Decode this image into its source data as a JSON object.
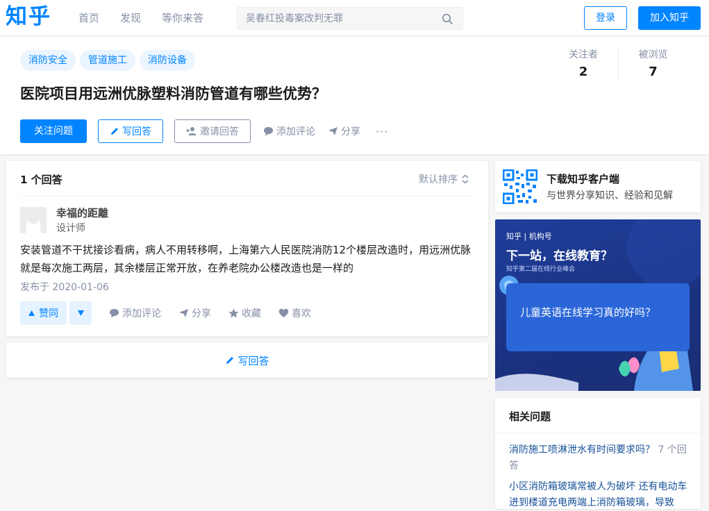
{
  "header": {
    "logo": "知乎",
    "nav": [
      "首页",
      "发现",
      "等你来答"
    ],
    "search_placeholder": "吴春红投毒案改判无罪",
    "login": "登录",
    "join": "加入知乎"
  },
  "question": {
    "tags": [
      "消防安全",
      "管道施工",
      "消防设备"
    ],
    "title": "医院项目用远洲优脉塑料消防管道有哪些优势？",
    "followers_label": "关注者",
    "followers": "2",
    "views_label": "被浏览",
    "views": "7",
    "actions": {
      "follow": "关注问题",
      "write": "写回答",
      "invite": "邀请回答",
      "comment": "添加评论",
      "share": "分享",
      "more": "···"
    }
  },
  "answers": {
    "count_label": "1 个回答",
    "sort_label": "默认排序",
    "items": [
      {
        "author": "幸福的距離",
        "author_title": "设计师",
        "content": "安装管道不干扰接诊看病，病人不用转移啊，上海第六人民医院消防12个楼层改造时，用远洲优脉就是每次施工两层，其余楼层正常开放，在养老院办公楼改造也是一样的",
        "date": "发布于 2020-01-06",
        "upvote": "赞同",
        "comment": "添加评论",
        "share": "分享",
        "collect": "收藏",
        "like": "喜欢"
      }
    ],
    "write_answer": "写回答"
  },
  "sidebar": {
    "download_title": "下载知乎客户端",
    "download_sub": "与世界分享知识、经验和见解",
    "banner": {
      "brand": "知乎 | 机构号",
      "headline": "下一站，在线教育？",
      "sub": "知乎第二届在线行业峰会",
      "question": "儿童英语在线学习真的好吗？"
    },
    "related_title": "相关问题",
    "related": [
      {
        "title": "消防施工喷淋泄水有时间要求吗？",
        "count": "7 个回答"
      },
      {
        "title": "小区消防箱玻璃常被人为破坏 还有电动车进到楼道充电两端上消防箱玻璃，导致",
        "count": ""
      }
    ]
  },
  "colors": {
    "brand": "#0084ff",
    "muted": "#8590a6",
    "link": "#175199"
  }
}
